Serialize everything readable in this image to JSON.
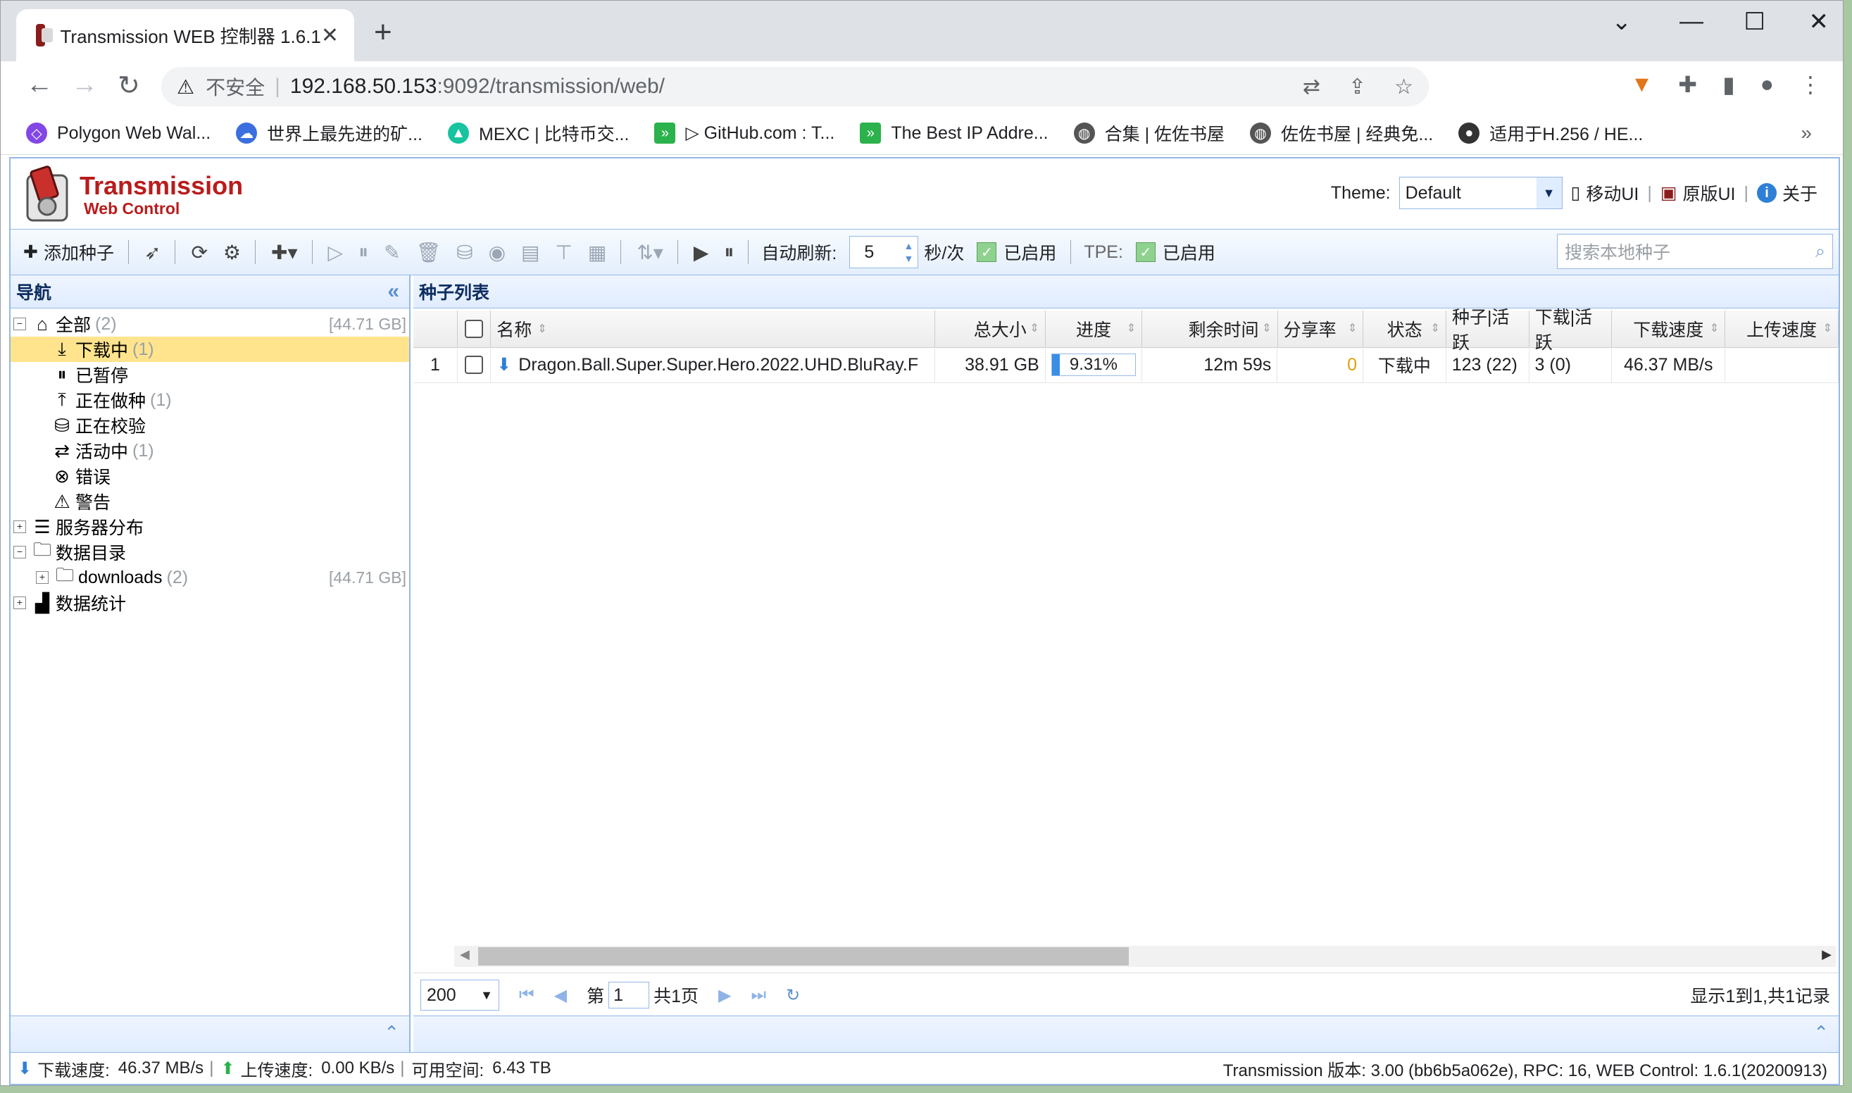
{
  "browser": {
    "tab_title": "Transmission WEB 控制器 1.6.1",
    "url_warning": "不安全",
    "url_host": "192.168.50.153",
    "url_path": ":9092/transmission/web/",
    "bookmarks": [
      {
        "label": "Polygon Web Wal...",
        "color": "#8247e5"
      },
      {
        "label": "世界上最先进的矿...",
        "color": "#3b6fe0"
      },
      {
        "label": "MEXC | 比特币交...",
        "color": "#18c39f"
      },
      {
        "label": "▷ GitHub.com : T...",
        "color": "#2bb24c"
      },
      {
        "label": "The Best IP Addre...",
        "color": "#2bb24c"
      },
      {
        "label": "合集 | 佐佐书屋",
        "color": "#555555"
      },
      {
        "label": "佐佐书屋 | 经典免...",
        "color": "#555555"
      },
      {
        "label": "适用于H.256 / HE...",
        "color": "#333333"
      }
    ],
    "bookmarks_more": "»"
  },
  "header": {
    "logo_title": "Transmission",
    "logo_subtitle": "Web Control",
    "theme_label": "Theme:",
    "theme_value": "Default",
    "mobile_ui": "移动UI",
    "original_ui": "原版UI",
    "about": "关于"
  },
  "toolbar": {
    "add_torrent": "添加种子",
    "auto_refresh_label": "自动刷新:",
    "refresh_interval": "5",
    "interval_unit": "秒/次",
    "enabled_1": "已启用",
    "tpe_label": "TPE:",
    "enabled_2": "已启用",
    "search_placeholder": "搜索本地种子"
  },
  "nav": {
    "title": "导航",
    "items": [
      {
        "label": "全部",
        "count": "(2)",
        "size": "[44.71 GB]"
      },
      {
        "label": "下载中",
        "count": "(1)"
      },
      {
        "label": "已暂停",
        "count": ""
      },
      {
        "label": "正在做种",
        "count": "(1)"
      },
      {
        "label": "正在校验",
        "count": ""
      },
      {
        "label": "活动中",
        "count": "(1)"
      },
      {
        "label": "错误",
        "count": ""
      },
      {
        "label": "警告",
        "count": ""
      },
      {
        "label": "服务器分布",
        "count": ""
      },
      {
        "label": "数据目录",
        "count": ""
      },
      {
        "label": "downloads",
        "count": "(2)",
        "size": "[44.71 GB]"
      },
      {
        "label": "数据统计",
        "count": ""
      }
    ]
  },
  "list": {
    "title": "种子列表",
    "columns": [
      "名称",
      "总大小",
      "进度",
      "剩余时间",
      "分享率",
      "状态",
      "种子|活跃",
      "下载|活跃",
      "下载速度",
      "上传速度"
    ],
    "rows": [
      {
        "index": "1",
        "name": "Dragon.Ball.Super.Super.Hero.2022.UHD.BluRay.F",
        "size": "38.91 GB",
        "progress": 9.31,
        "progress_text": "9.31%",
        "remaining": "12m 59s",
        "ratio": "0",
        "status": "下载中",
        "seeds": "123 (22)",
        "peers": "3 (0)",
        "dl_speed": "46.37 MB/s",
        "ul_speed": ""
      }
    ],
    "page_size": "200",
    "page_prefix": "第",
    "page_num": "1",
    "page_total": "共1页",
    "summary": "显示1到1,共1记录"
  },
  "status": {
    "dl_label": "下载速度:",
    "dl_value": "46.37 MB/s",
    "ul_label": "上传速度:",
    "ul_value": "0.00 KB/s",
    "free_label": "可用空间:",
    "free_value": "6.43 TB",
    "version": "Transmission 版本: 3.00 (bb6b5a062e), RPC: 16, WEB Control: 1.6.1(20200913)"
  }
}
